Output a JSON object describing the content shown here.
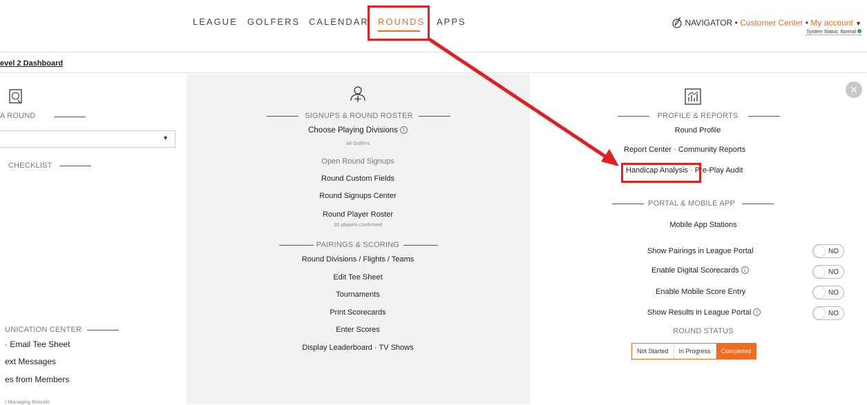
{
  "nav": {
    "tabs": [
      {
        "label": "LEAGUE"
      },
      {
        "label": "GOLFERS"
      },
      {
        "label": "CALENDAR"
      },
      {
        "label": "ROUNDS"
      },
      {
        "label": "APPS"
      }
    ],
    "active_tab": "ROUNDS",
    "navigator": "NAVIGATOR",
    "customer_center": "Customer Center",
    "my_account": "My account",
    "system_status": "System Status: Normal"
  },
  "breadcrumb": "evel 2 Dashboard",
  "left": {
    "section1": "A ROUND",
    "section2": "CHECKLIST",
    "section3": "UNICATION CENTER",
    "comm_items": [
      "· Email Tee Sheet",
      "ext Messages",
      "es from Members",
      "I Managing Rounds"
    ]
  },
  "center": {
    "signups_title": "SIGNUPS & ROUND ROSTER",
    "choose_divisions": "Choose Playing Divisions",
    "all_golfers": "All Golfers",
    "open_signups": "Open Round Signups",
    "custom_fields": "Round Custom Fields",
    "signups_center": "Round Signups Center",
    "player_roster": "Round Player Roster",
    "players_confirmed": "30 players confirmed",
    "pairings_title": "PAIRINGS & SCORING",
    "pairings_items": [
      "Round Divisions / Flights / Teams",
      "Edit Tee Sheet",
      "Tournaments",
      "Print Scorecards",
      "Enter Scores",
      "Display Leaderboard · TV Shows"
    ]
  },
  "right": {
    "profile_title": "PROFILE & REPORTS",
    "round_profile": "Round Profile",
    "report_center": "Report Center",
    "community_reports": "Community Reports",
    "handicap_analysis": "Handicap Analysis",
    "pre_play_audit": "Pre-Play Audit",
    "portal_title": "PORTAL & MOBILE APP",
    "mobile_stations": "Mobile App Stations",
    "toggles": [
      {
        "label": "Show Pairings in League Portal",
        "value": "NO"
      },
      {
        "label": "Enable Digital Scorecards",
        "value": "NO"
      },
      {
        "label": "Enable Mobile Score Entry",
        "value": "NO"
      },
      {
        "label": "Show Results in League Portal",
        "value": "NO"
      }
    ],
    "round_status_title": "ROUND STATUS",
    "status_options": [
      "Not Started",
      "In Progress",
      "Completed"
    ],
    "active_status": "Completed"
  },
  "colors": {
    "accent": "#f26b22",
    "annotation": "#e02020"
  }
}
